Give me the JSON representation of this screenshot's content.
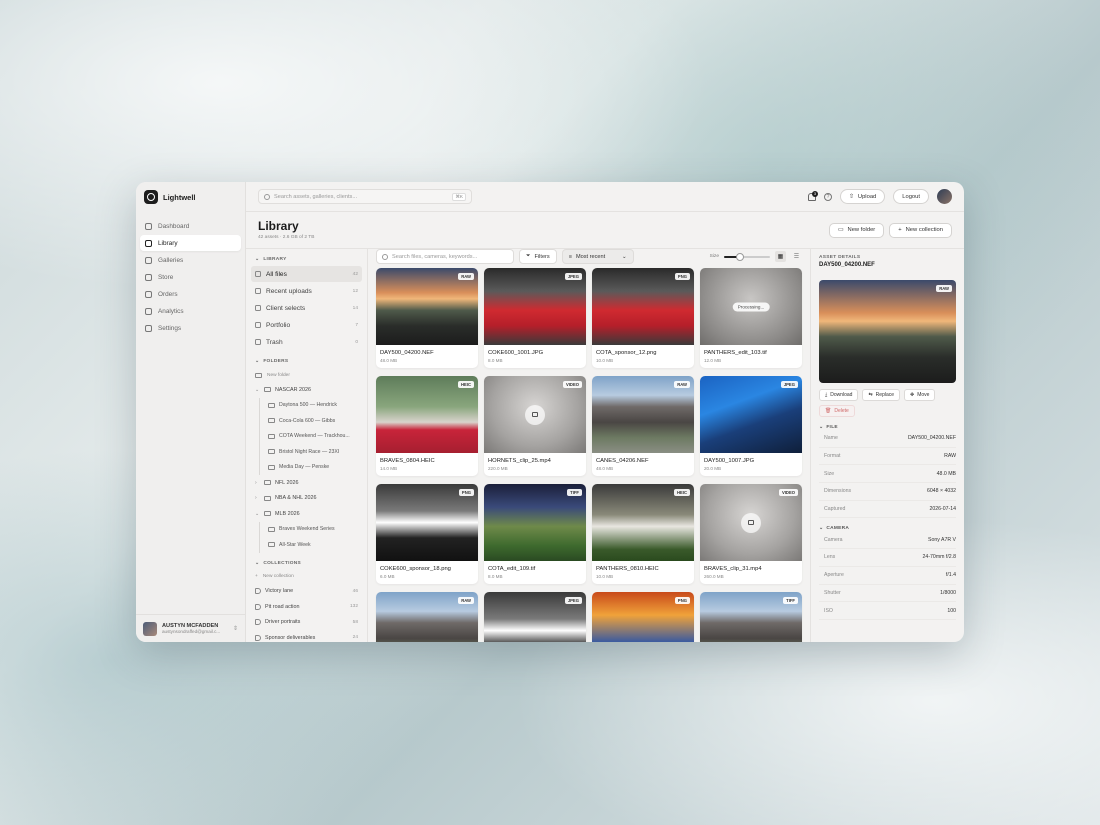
{
  "brand": {
    "name": "Lightwell"
  },
  "nav": [
    {
      "label": "Dashboard",
      "icon": "dashboard-icon",
      "active": false
    },
    {
      "label": "Library",
      "icon": "folder-icon",
      "active": true
    },
    {
      "label": "Galleries",
      "icon": "image-icon",
      "active": false
    },
    {
      "label": "Store",
      "icon": "store-icon",
      "active": false
    },
    {
      "label": "Orders",
      "icon": "box-icon",
      "active": false
    },
    {
      "label": "Analytics",
      "icon": "chart-icon",
      "active": false
    },
    {
      "label": "Settings",
      "icon": "gear-icon",
      "active": false
    }
  ],
  "user": {
    "name": "AUSTYN MCFADDEN",
    "email": "austynsondraffed@gmail.c..."
  },
  "topbar": {
    "search_placeholder": "Search assets, galleries, clients...",
    "search_shortcut": "⌘K",
    "notifications": "3",
    "upload_label": "Upload",
    "logout_label": "Logout"
  },
  "header": {
    "title": "Library",
    "subtitle": "42 assets · 2.6 GB of 2 TB",
    "new_folder": "New folder",
    "new_collection": "New collection"
  },
  "tree": {
    "library_title": "LIBRARY",
    "library_items": [
      {
        "label": "All files",
        "count": "42",
        "active": true
      },
      {
        "label": "Recent uploads",
        "count": "12",
        "active": false
      },
      {
        "label": "Client selects",
        "count": "14",
        "active": false
      },
      {
        "label": "Portfolio",
        "count": "7",
        "active": false
      },
      {
        "label": "Trash",
        "count": "0",
        "active": false
      }
    ],
    "folders_title": "FOLDERS",
    "new_folder": "New folder",
    "folders": [
      {
        "label": "NASCAR 2026",
        "open": true,
        "children": [
          "Daytona 500 — Hendrick",
          "Coca-Cola 600 — Gibbs",
          "COTA Weekend — Trackhou...",
          "Bristol Night Race — 23XI",
          "Media Day — Penske"
        ]
      },
      {
        "label": "NFL 2026",
        "open": false,
        "children": []
      },
      {
        "label": "NBA & NHL 2026",
        "open": false,
        "children": []
      },
      {
        "label": "MLB 2026",
        "open": true,
        "children": [
          "Braves Weekend Series",
          "All-Star Week"
        ]
      }
    ],
    "collections_title": "COLLECTIONS",
    "new_collection": "New collection",
    "collections": [
      {
        "label": "Victory lane",
        "count": "46"
      },
      {
        "label": "Pit road action",
        "count": "132"
      },
      {
        "label": "Driver portraits",
        "count": "58"
      },
      {
        "label": "Sponsor deliverables",
        "count": "24"
      }
    ]
  },
  "gridbar": {
    "search_placeholder": "Search files, cameras, keywords...",
    "filters_label": "Filters",
    "sort_label": "Most recent",
    "size_label": "Size",
    "size_value": 0.35
  },
  "assets": [
    {
      "name": "DAY500_04200.NEF",
      "size": "48.0 MB",
      "badge": "RAW",
      "thumb": "t-sunset",
      "state": ""
    },
    {
      "name": "COKE600_1001.JPG",
      "size": "8.0 MB",
      "badge": "JPEG",
      "thumb": "t-pit",
      "state": ""
    },
    {
      "name": "COTA_sponsor_12.png",
      "size": "10.0 MB",
      "badge": "PNG",
      "thumb": "t-pit",
      "state": ""
    },
    {
      "name": "PANTHERS_edit_103.tif",
      "size": "12.0 MB",
      "badge": "",
      "thumb": "t-blur",
      "state": "Processing..."
    },
    {
      "name": "BRAVES_0804.HEIC",
      "size": "14.0 MB",
      "badge": "HEIC",
      "thumb": "t-baseball",
      "state": ""
    },
    {
      "name": "HORNETS_clip_25.mp4",
      "size": "220.0 MB",
      "badge": "VIDEO",
      "thumb": "t-video",
      "state": "video"
    },
    {
      "name": "CANES_04206.NEF",
      "size": "48.0 MB",
      "badge": "RAW",
      "thumb": "t-stadium",
      "state": ""
    },
    {
      "name": "DAY500_1007.JPG",
      "size": "20.0 MB",
      "badge": "JPEG",
      "thumb": "t-blue",
      "state": ""
    },
    {
      "name": "COKE600_sponsor_18.png",
      "size": "6.0 MB",
      "badge": "PNG",
      "thumb": "t-crew",
      "state": ""
    },
    {
      "name": "COTA_edit_109.tif",
      "size": "8.0 MB",
      "badge": "TIFF",
      "thumb": "t-field",
      "state": ""
    },
    {
      "name": "PANTHERS_0810.HEIC",
      "size": "10.0 MB",
      "badge": "HEIC",
      "thumb": "t-pitch",
      "state": ""
    },
    {
      "name": "BRAVES_clip_31.mp4",
      "size": "260.0 MB",
      "badge": "VIDEO",
      "thumb": "t-video",
      "state": "video"
    },
    {
      "name": "",
      "size": "",
      "badge": "RAW",
      "thumb": "t-stadium",
      "state": ""
    },
    {
      "name": "",
      "size": "",
      "badge": "JPEG",
      "thumb": "t-crew",
      "state": ""
    },
    {
      "name": "",
      "size": "",
      "badge": "PNG",
      "thumb": "t-show",
      "state": ""
    },
    {
      "name": "",
      "size": "",
      "badge": "TIFF",
      "thumb": "t-stadium",
      "state": ""
    }
  ],
  "details": {
    "title": "ASSET DETAILS",
    "file": "DAY500_04200.NEF",
    "badge": "RAW",
    "download": "Download",
    "replace": "Replace",
    "move": "Move",
    "delete": "Delete",
    "file_section": "FILE",
    "file_rows": [
      {
        "k": "Name",
        "v": "DAY500_04200.NEF"
      },
      {
        "k": "Format",
        "v": "RAW"
      },
      {
        "k": "Size",
        "v": "48.0 MB"
      },
      {
        "k": "Dimensions",
        "v": "6048 × 4032"
      },
      {
        "k": "Captured",
        "v": "2026-07-14"
      }
    ],
    "camera_section": "CAMERA",
    "camera_rows": [
      {
        "k": "Camera",
        "v": "Sony A7R V"
      },
      {
        "k": "Lens",
        "v": "24-70mm f/2.8"
      },
      {
        "k": "Aperture",
        "v": "f/1.4"
      },
      {
        "k": "Shutter",
        "v": "1/8000"
      },
      {
        "k": "ISO",
        "v": "100"
      }
    ]
  }
}
